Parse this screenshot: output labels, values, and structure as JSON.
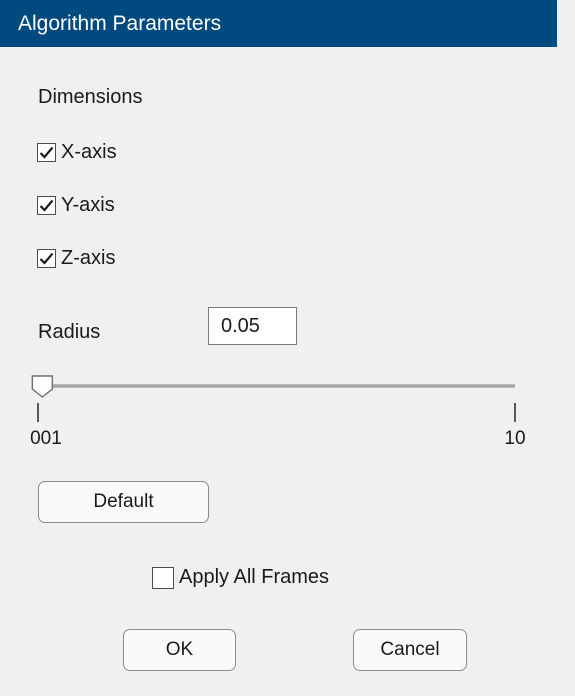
{
  "window": {
    "title": "Algorithm Parameters"
  },
  "dimensions": {
    "label": "Dimensions",
    "options": [
      {
        "label": "X-axis",
        "checked": true
      },
      {
        "label": "Y-axis",
        "checked": true
      },
      {
        "label": "Z-axis",
        "checked": true
      }
    ]
  },
  "radius": {
    "label": "Radius",
    "value": "0.05",
    "slider": {
      "min_label": "0.001",
      "max_label": "10",
      "min": 0.001,
      "max": 10,
      "value": 0.05
    }
  },
  "buttons": {
    "default_label": "Default",
    "ok_label": "OK",
    "cancel_label": "Cancel"
  },
  "apply_all_frames": {
    "label": "Apply All Frames",
    "checked": false
  },
  "colors": {
    "title_bar": "#004a7f",
    "background": "#f0f0f0",
    "slider_track": "#a6a6a6"
  }
}
